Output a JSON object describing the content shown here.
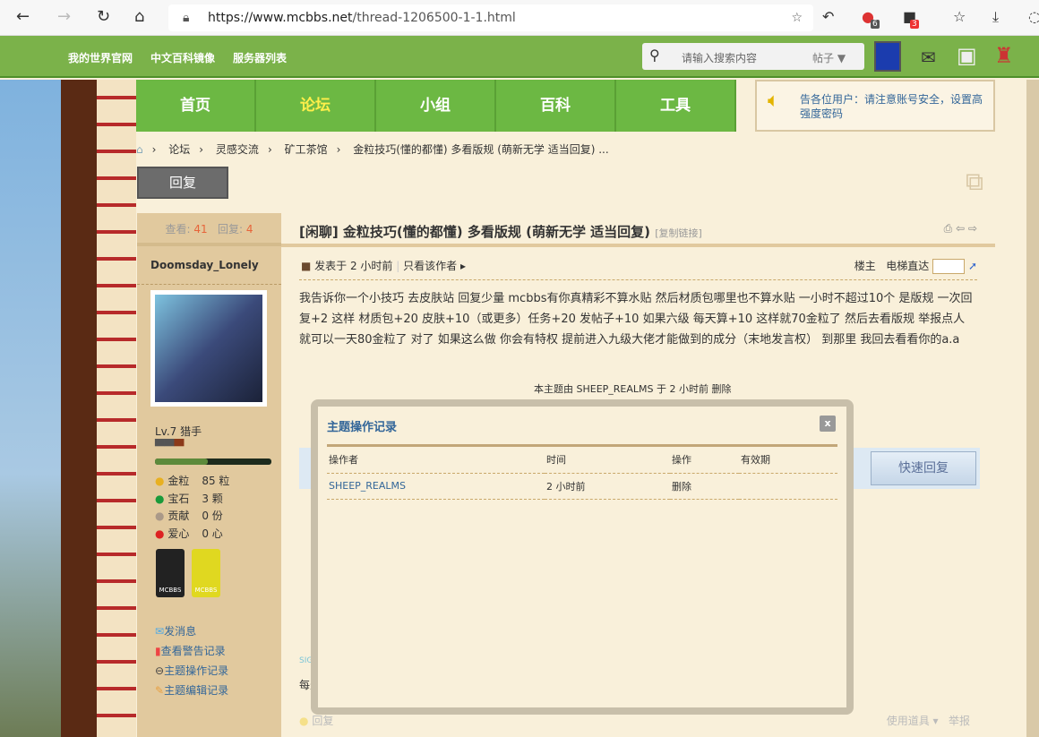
{
  "browser": {
    "url_host": "https://www.mcbbs.net",
    "url_path": "/thread-1206500-1-1.html",
    "badge1": "6",
    "badge2": "3"
  },
  "topbar": {
    "links": [
      "我的世界官网",
      "中文百科镜像",
      "服务器列表"
    ],
    "search_placeholder": "请输入搜索内容",
    "search_type": "帖子"
  },
  "nav": [
    "首页",
    "论坛",
    "小组",
    "百科",
    "工具"
  ],
  "notice": "告各位用户：请注意账号安全，设置高强度密码",
  "breadcrumb": [
    "论坛",
    "灵感交流",
    "矿工茶馆",
    "金粒技巧(懂的都懂)  多看版规  (萌新无学 适当回复) ..."
  ],
  "reply_button": "回复",
  "stats": {
    "views_label": "查看:",
    "views": "41",
    "replies_label": "回复:",
    "replies": "4"
  },
  "user": {
    "name": "Doomsday_Lonely",
    "level": "Lv.7 猎手",
    "attrs": [
      {
        "label": "金粒",
        "value": "85 粒"
      },
      {
        "label": "宝石",
        "value": "3 颗"
      },
      {
        "label": "贡献",
        "value": "0 份"
      },
      {
        "label": "爱心",
        "value": "0 心"
      }
    ],
    "medal_text": "MCBBS",
    "links": [
      "发消息",
      "查看警告记录",
      "主题操作记录",
      "主题编辑记录"
    ]
  },
  "post": {
    "title": "[闲聊] 金粒技巧(懂的都懂)  多看版规  (萌新无学 适当回复)",
    "copy_link": "[复制链接]",
    "posted": "发表于 2 小时前",
    "only_author": "只看该作者",
    "floor": "楼主",
    "jump": "电梯直达",
    "body": "我告诉你一个小技巧 去皮肤站 回复少量 mcbbs有你真精彩不算水贴 然后材质包哪里也不算水贴 一小时不超过10个 是版规 一次回复+2 这样 材质包+20 皮肤+10（或更多）任务+20 发帖子+10 如果六级 每天算+10 这样就70金粒了 然后去看版规 举报点人 就可以一天80金粒了 对了 如果这么做 你会有特权 提前进入九级大佬才能做到的成分（末地发言权） 到那里 我回去看看你的a.a",
    "deleted_note": "本主题由 SHEEP_REALMS 于 2 小时前 删除",
    "quick_reply": "快速回复",
    "sign": "SIGN",
    "sig_text": "每天",
    "reply": "回复",
    "use_item": "使用道具",
    "report": "举报"
  },
  "dialog": {
    "title": "主题操作记录",
    "close": "x",
    "headers": [
      "操作者",
      "时间",
      "操作",
      "有效期"
    ],
    "rows": [
      [
        "SHEEP_REALMS",
        "2 小时前",
        "删除",
        ""
      ]
    ]
  }
}
